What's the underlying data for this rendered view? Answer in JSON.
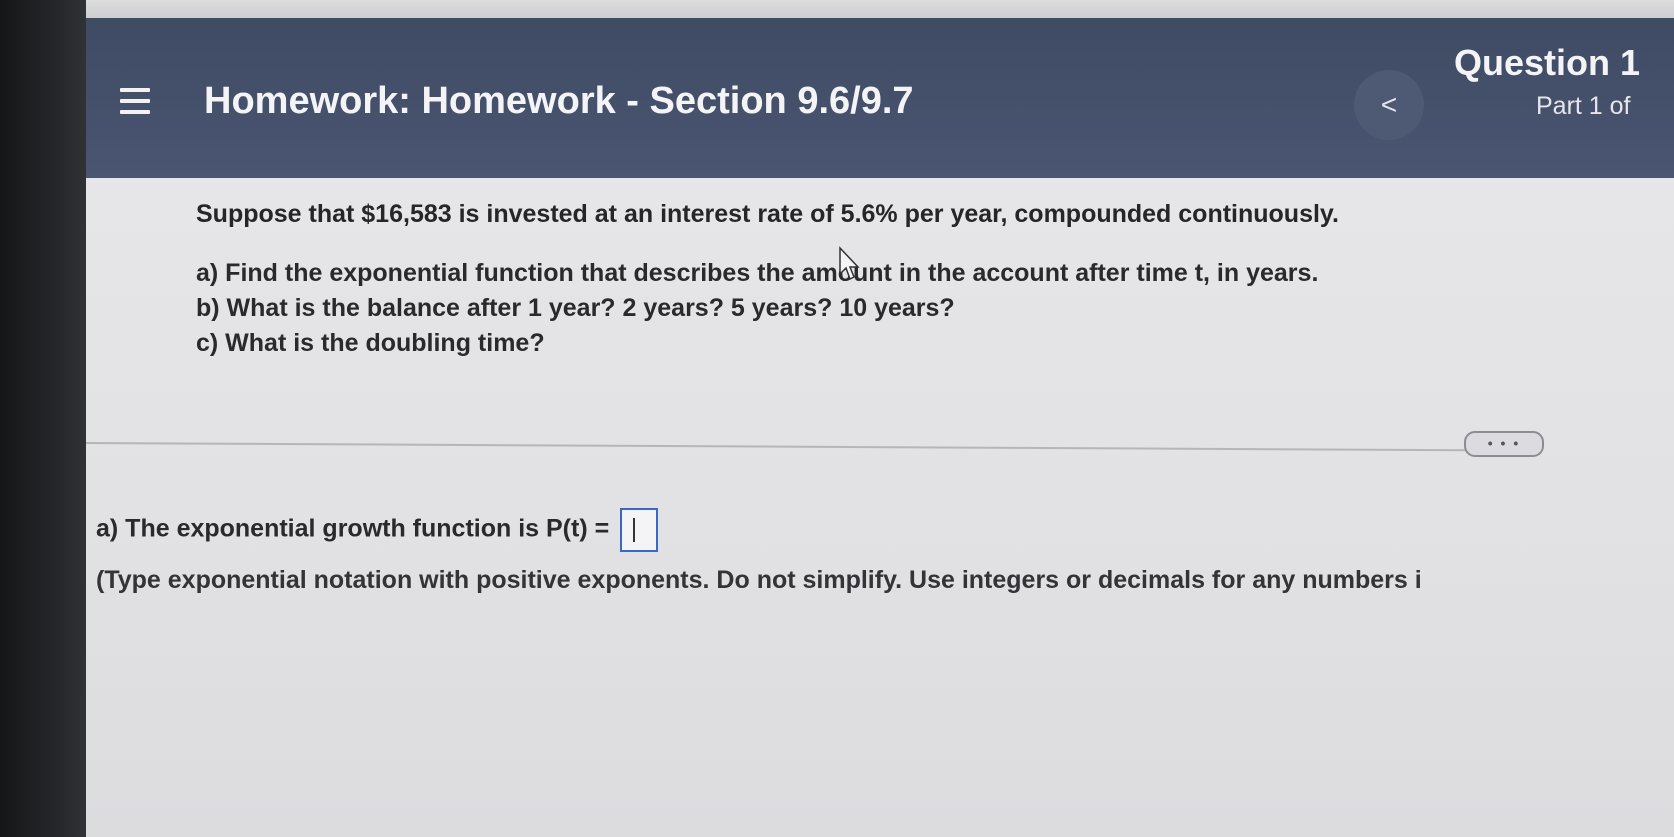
{
  "header": {
    "title": "Homework: Homework - Section 9.6/9.7",
    "back_label": "<",
    "question_title": "Question 1",
    "question_part": "Part 1 of"
  },
  "problem": {
    "intro": "Suppose that $16,583 is invested at an interest rate of 5.6% per year, compounded continuously.",
    "parts": [
      "a) Find the exponential function that describes the amount in the account after time t, in years.",
      "b) What is the balance after 1 year? 2 years? 5 years? 10 years?",
      "c) What is the doubling time?"
    ]
  },
  "more_button_label": "• • •",
  "answer": {
    "prompt": "a) The exponential growth function is P(t) =",
    "input_value": "",
    "instruction": "(Type exponential notation with positive exponents. Do not simplify. Use integers or decimals for any numbers i"
  },
  "colors": {
    "header": "#45516b",
    "input_border": "#3a67c8"
  }
}
